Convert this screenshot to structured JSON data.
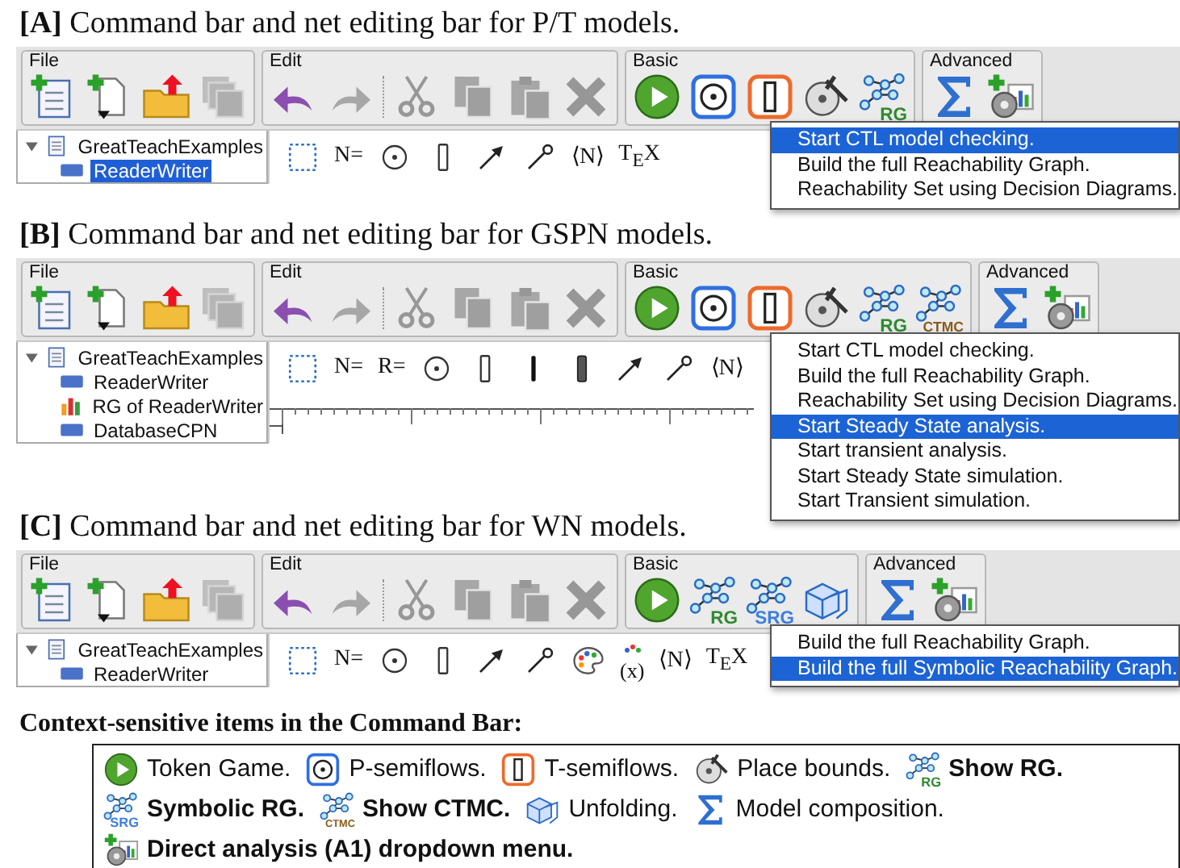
{
  "panels": [
    {
      "caption": "**[A]** Command bar and net editing bar for P/T models.",
      "toolbar": [
        {
          "label": "File",
          "items": [
            {
              "kind": "new-net",
              "disabled": false
            },
            {
              "kind": "new-page",
              "disabled": false
            },
            {
              "kind": "open",
              "disabled": false
            },
            {
              "kind": "windows",
              "disabled": true
            }
          ]
        },
        {
          "label": "Edit",
          "items": [
            {
              "kind": "undo",
              "disabled": false
            },
            {
              "kind": "redo",
              "disabled": true
            },
            {
              "kind": "cut",
              "disabled": true,
              "separator_before": true
            },
            {
              "kind": "copy",
              "disabled": true
            },
            {
              "kind": "paste",
              "disabled": true
            },
            {
              "kind": "delete",
              "disabled": true
            }
          ]
        },
        {
          "label": "Basic",
          "items": [
            {
              "kind": "play",
              "disabled": false
            },
            {
              "kind": "p-semiflow",
              "disabled": false
            },
            {
              "kind": "t-semiflow",
              "disabled": false
            },
            {
              "kind": "bounds",
              "disabled": false
            },
            {
              "kind": "graph",
              "badge": "RG",
              "color": "#2e8b2e",
              "disabled": false
            }
          ]
        },
        {
          "label": "Advanced",
          "items": [
            {
              "kind": "sigma",
              "disabled": false
            },
            {
              "kind": "direct",
              "disabled": false
            }
          ]
        }
      ],
      "tree": {
        "label": "GreatTeachExamples",
        "expanded": true,
        "children": [
          {
            "label": "ReaderWriter",
            "kind": "net",
            "selected": true
          }
        ]
      },
      "tools": [
        {
          "kind": "select"
        },
        {
          "kind": "text",
          "text": "N="
        },
        {
          "kind": "place"
        },
        {
          "kind": "transition"
        },
        {
          "kind": "arc"
        },
        {
          "kind": "inhibitor"
        },
        {
          "kind": "text",
          "text": "⟨N⟩"
        },
        {
          "kind": "text",
          "text": "T$_{E}$X"
        }
      ],
      "menu": [
        {
          "label": "Start CTL model checking.",
          "selected": true
        },
        {
          "label": "Build the full Reachability Graph.",
          "selected": false
        },
        {
          "label": "Reachability Set using Decision Diagrams.",
          "selected": false
        }
      ]
    },
    {
      "caption": "**[B]** Command bar and net editing bar for GSPN models.",
      "toolbar": [
        {
          "label": "File",
          "items": [
            {
              "kind": "new-net",
              "disabled": false
            },
            {
              "kind": "new-page",
              "disabled": false
            },
            {
              "kind": "open",
              "disabled": false
            },
            {
              "kind": "windows",
              "disabled": true
            }
          ]
        },
        {
          "label": "Edit",
          "items": [
            {
              "kind": "undo",
              "disabled": false
            },
            {
              "kind": "redo",
              "disabled": true
            },
            {
              "kind": "cut",
              "disabled": true,
              "separator_before": true
            },
            {
              "kind": "copy",
              "disabled": true
            },
            {
              "kind": "paste",
              "disabled": true
            },
            {
              "kind": "delete",
              "disabled": true
            }
          ]
        },
        {
          "label": "Basic",
          "items": [
            {
              "kind": "play",
              "disabled": false
            },
            {
              "kind": "p-semiflow",
              "disabled": false
            },
            {
              "kind": "t-semiflow",
              "disabled": false
            },
            {
              "kind": "bounds",
              "disabled": false
            },
            {
              "kind": "graph",
              "badge": "RG",
              "color": "#2e8b2e",
              "disabled": false
            },
            {
              "kind": "graph",
              "badge": "CTMC",
              "color": "#8a5a1a",
              "disabled": false
            }
          ]
        },
        {
          "label": "Advanced",
          "items": [
            {
              "kind": "sigma",
              "disabled": false
            },
            {
              "kind": "direct",
              "disabled": false
            }
          ]
        }
      ],
      "tree": {
        "label": "GreatTeachExamples",
        "expanded": true,
        "children": [
          {
            "label": "ReaderWriter",
            "kind": "net",
            "selected": false
          },
          {
            "label": "RG of ReaderWriter",
            "kind": "chart",
            "selected": false
          },
          {
            "label": "DatabaseCPN",
            "kind": "net",
            "selected": false
          }
        ]
      },
      "tools": [
        {
          "kind": "select"
        },
        {
          "kind": "text",
          "text": "N="
        },
        {
          "kind": "text",
          "text": "R="
        },
        {
          "kind": "place"
        },
        {
          "kind": "transition"
        },
        {
          "kind": "immediate"
        },
        {
          "kind": "general"
        },
        {
          "kind": "arc"
        },
        {
          "kind": "inhibitor"
        },
        {
          "kind": "text",
          "text": "⟨N⟩"
        }
      ],
      "ruler": true,
      "menu": [
        {
          "label": "Start CTL model checking.",
          "selected": false
        },
        {
          "label": "Build the full Reachability Graph.",
          "selected": false
        },
        {
          "label": "Reachability Set using Decision Diagrams.",
          "selected": false
        },
        {
          "label": "Start Steady State analysis.",
          "selected": true
        },
        {
          "label": "Start transient analysis.",
          "selected": false
        },
        {
          "label": "Start Steady State simulation.",
          "selected": false
        },
        {
          "label": "Start Transient simulation.",
          "selected": false
        }
      ]
    },
    {
      "caption": "**[C]** Command bar and net editing bar for WN models.",
      "toolbar": [
        {
          "label": "File",
          "items": [
            {
              "kind": "new-net",
              "disabled": false
            },
            {
              "kind": "new-page",
              "disabled": false
            },
            {
              "kind": "open",
              "disabled": false
            },
            {
              "kind": "windows",
              "disabled": true
            }
          ]
        },
        {
          "label": "Edit",
          "items": [
            {
              "kind": "undo",
              "disabled": false
            },
            {
              "kind": "redo",
              "disabled": true
            },
            {
              "kind": "cut",
              "disabled": true,
              "separator_before": true
            },
            {
              "kind": "copy",
              "disabled": true
            },
            {
              "kind": "paste",
              "disabled": true
            },
            {
              "kind": "delete",
              "disabled": true
            }
          ]
        },
        {
          "label": "Basic",
          "items": [
            {
              "kind": "play",
              "disabled": false
            },
            {
              "kind": "graph",
              "badge": "RG",
              "color": "#2e8b2e",
              "disabled": false
            },
            {
              "kind": "graph",
              "badge": "SRG",
              "color": "#3d7ee0",
              "disabled": false
            },
            {
              "kind": "unfolding",
              "disabled": false
            }
          ]
        },
        {
          "label": "Advanced",
          "items": [
            {
              "kind": "sigma",
              "disabled": false
            },
            {
              "kind": "direct",
              "disabled": false
            }
          ]
        }
      ],
      "tree": {
        "label": "GreatTeachExamples",
        "expanded": true,
        "children": [
          {
            "label": "ReaderWriter",
            "kind": "net",
            "selected": false
          }
        ]
      },
      "tools": [
        {
          "kind": "select"
        },
        {
          "kind": "text",
          "text": "N="
        },
        {
          "kind": "place"
        },
        {
          "kind": "transition"
        },
        {
          "kind": "arc"
        },
        {
          "kind": "inhibitor"
        },
        {
          "kind": "palette"
        },
        {
          "kind": "color-var",
          "text": "(x)"
        },
        {
          "kind": "text",
          "text": "⟨N⟩"
        },
        {
          "kind": "text",
          "text": "T$_{E}$X"
        }
      ],
      "menu": [
        {
          "label": "Build the full Reachability Graph.",
          "selected": false
        },
        {
          "label": "Build the full Symbolic Reachability Graph.",
          "selected": true
        }
      ]
    }
  ],
  "legend": {
    "title": "Context-sensitive items in the Command Bar:",
    "lines": [
      [
        {
          "kind": "play",
          "label": "Token Game.",
          "bold": false
        },
        {
          "kind": "p-semiflow",
          "label": "P-semiflows.",
          "bold": false
        },
        {
          "kind": "t-semiflow",
          "label": "T-semiflows.",
          "bold": false
        },
        {
          "kind": "bounds",
          "label": "Place bounds.",
          "bold": false
        },
        {
          "kind": "graph",
          "badge": "RG",
          "color": "#2e8b2e",
          "label": "Show RG.",
          "bold": true
        }
      ],
      [
        {
          "kind": "graph",
          "badge": "SRG",
          "color": "#3d7ee0",
          "label": "Symbolic RG.",
          "bold": true
        },
        {
          "kind": "graph",
          "badge": "CTMC",
          "color": "#8a5a1a",
          "label": "Show CTMC.",
          "bold": true
        },
        {
          "kind": "unfolding",
          "label": "Unfolding.",
          "bold": false
        },
        {
          "kind": "sigma",
          "label": "Model composition.",
          "bold": false
        }
      ],
      [
        {
          "kind": "direct",
          "label": "Direct analysis (A1) dropdown menu.",
          "bold": true
        }
      ]
    ]
  }
}
